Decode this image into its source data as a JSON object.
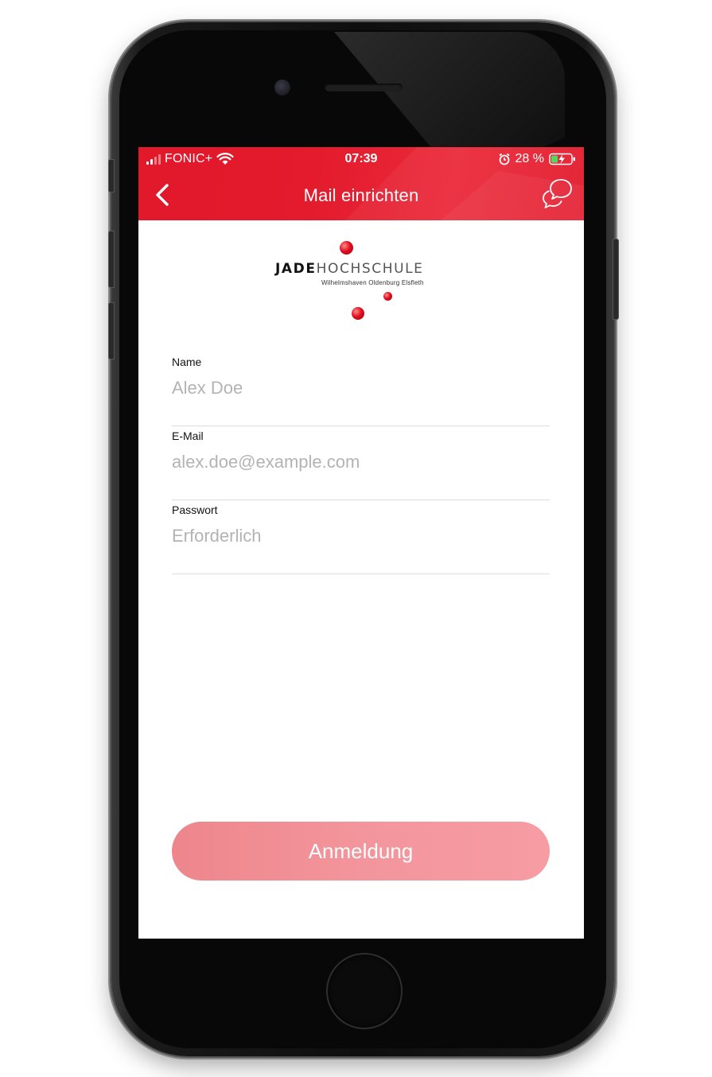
{
  "status_bar": {
    "carrier": "FONIC+",
    "time": "07:39",
    "battery_percent": "28 %",
    "signal_bars": 2,
    "charging": true
  },
  "nav": {
    "title": "Mail einrichten",
    "back_icon": "chevron-left-icon",
    "chat_icon": "chat-bubbles-icon"
  },
  "logo": {
    "jade": "JADE",
    "hochschule": "HOCHSCHULE",
    "subtitle": "Wilhelmshaven Oldenburg Elsfleth"
  },
  "form": {
    "name": {
      "label": "Name",
      "placeholder": "Alex Doe",
      "value": ""
    },
    "email": {
      "label": "E-Mail",
      "placeholder": "alex.doe@example.com",
      "value": ""
    },
    "password": {
      "label": "Passwort",
      "placeholder": "Erforderlich",
      "value": ""
    }
  },
  "submit": {
    "label": "Anmeldung",
    "enabled": false
  },
  "colors": {
    "brand_red": "#e31b2d",
    "button_disabled": "#f3959c",
    "placeholder": "#b3b3b3",
    "divider": "#dcdcdc"
  }
}
